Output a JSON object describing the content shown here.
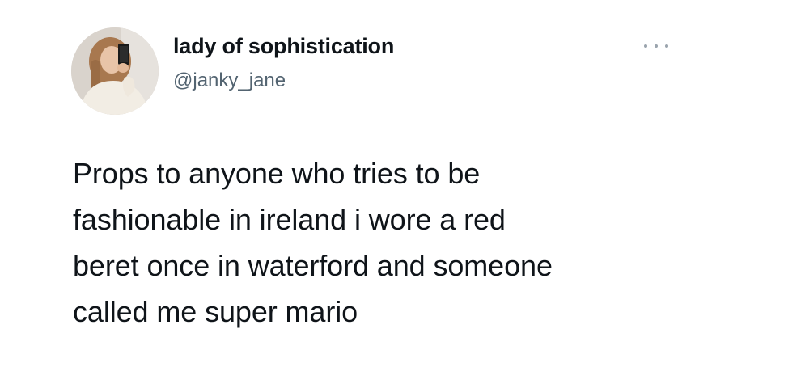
{
  "tweet": {
    "author": {
      "display_name": "lady of sophistication",
      "handle": "@janky_jane",
      "avatar_icon": "profile-photo"
    },
    "more_icon": "more-options-icon",
    "text": "Props to anyone who tries to be\nfashionable in ireland i wore a red\nberet once in waterford and someone\ncalled me super mario"
  },
  "colors": {
    "primary_text": "#0f1419",
    "secondary_text": "#536471",
    "background": "#ffffff"
  }
}
